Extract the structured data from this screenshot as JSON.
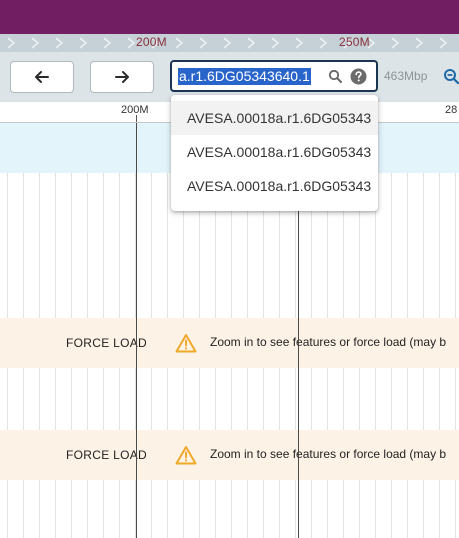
{
  "overview": {
    "labels": [
      "200M",
      "250M"
    ]
  },
  "navigation": {
    "back_icon": "arrow-left-icon",
    "forward_icon": "arrow-right-icon"
  },
  "location_search": {
    "value": "a.r1.6DG05343640.1",
    "search_icon": "search-icon",
    "help_icon": "help-icon"
  },
  "assembly_size": "463Mbp",
  "zoom_icon": "zoom-icon",
  "ruler": {
    "labels": [
      "200M",
      "28"
    ]
  },
  "autocomplete": {
    "options": [
      "AVESA.00018a.r1.6DG05343",
      "AVESA.00018a.r1.6DG05343",
      "AVESA.00018a.r1.6DG05343"
    ]
  },
  "tracks": [
    {
      "force_load_label": "FORCE LOAD",
      "warning_icon": "warning-icon",
      "message": "Zoom in to see features or force load (may b"
    },
    {
      "force_load_label": "FORCE LOAD",
      "warning_icon": "warning-icon",
      "message": "Zoom in to see features or force load (may b"
    }
  ],
  "colors": {
    "header": "#721e63",
    "overview_bg": "#c5d1d6",
    "overview_label": "#8a2d3c",
    "selection": "#2864c9",
    "search_border": "#1b3553",
    "sequence_track": "#e3f4fb",
    "force_track": "#fdf2e6",
    "warning": "#f0a92b"
  }
}
